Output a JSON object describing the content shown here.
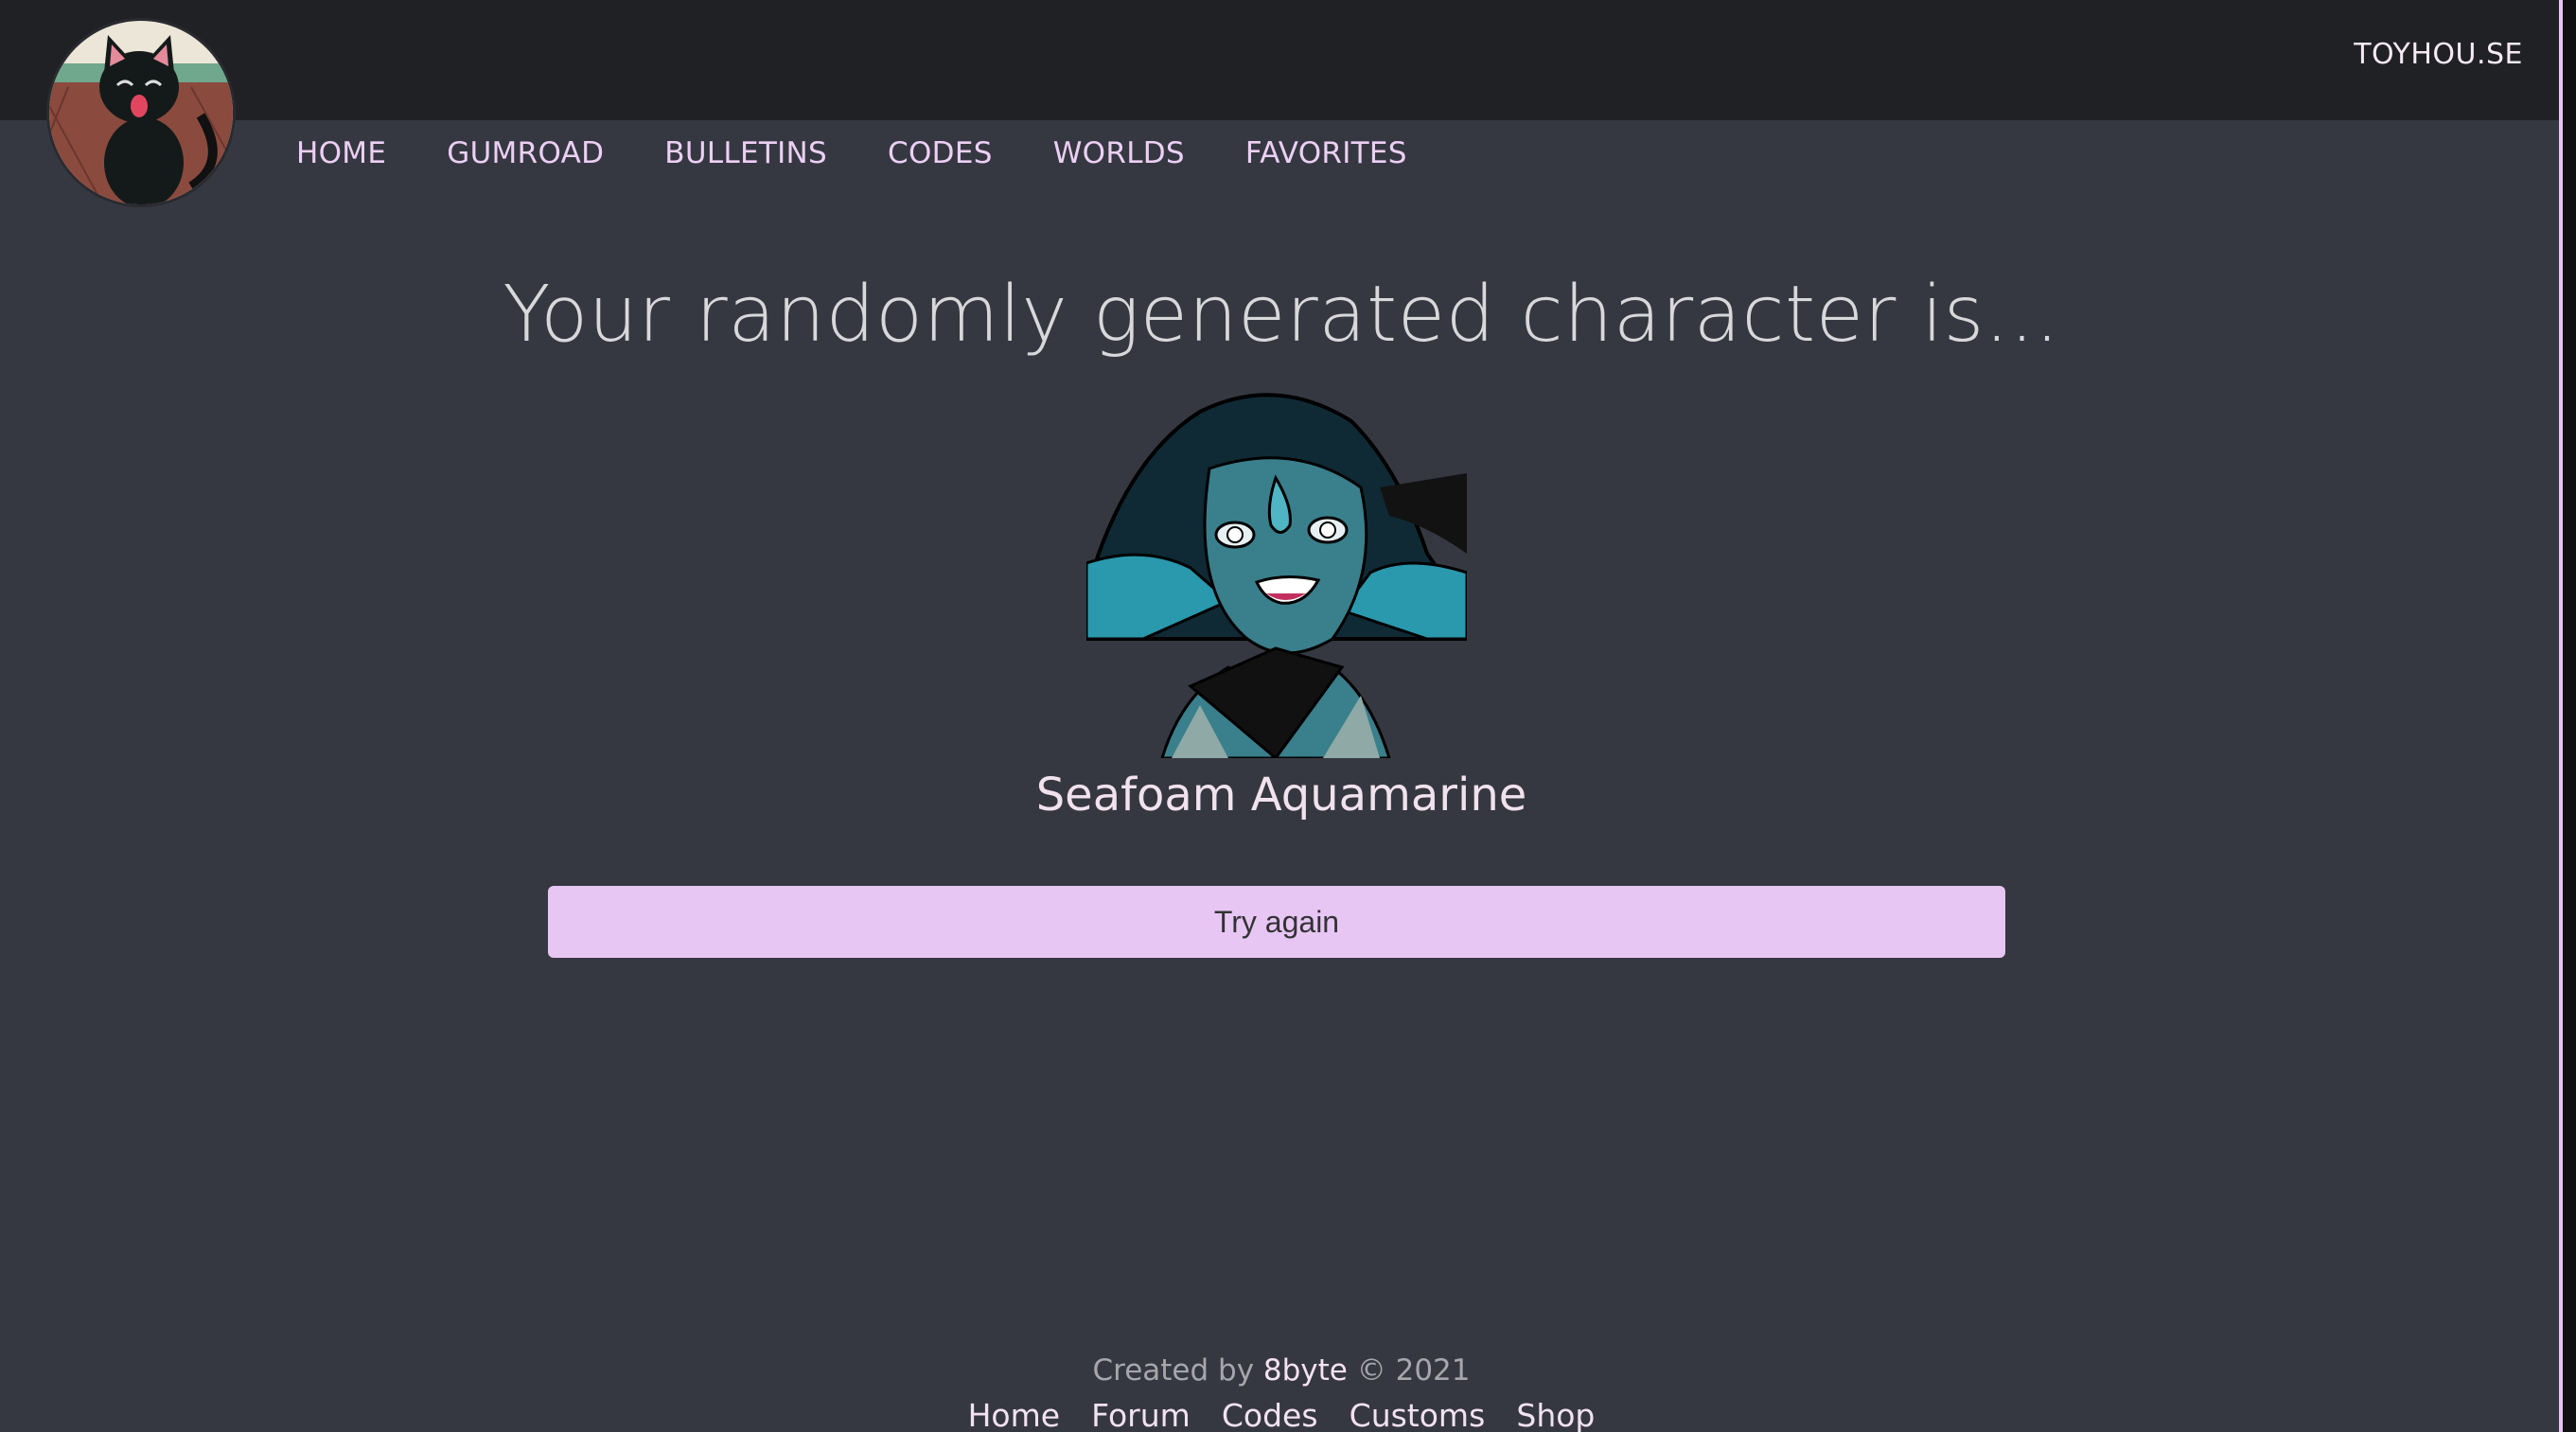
{
  "header": {
    "brand_link": "TOYHOU.SE"
  },
  "nav": {
    "items": [
      {
        "label": "HOME"
      },
      {
        "label": "GUMROAD"
      },
      {
        "label": "BULLETINS"
      },
      {
        "label": "CODES"
      },
      {
        "label": "WORLDS"
      },
      {
        "label": "FAVORITES"
      }
    ]
  },
  "main": {
    "heading": "Your randomly generated character is...",
    "character_name": "Seafoam Aquamarine",
    "try_again_label": "Try again"
  },
  "footer": {
    "created_by_prefix": "Created by",
    "author": "8byte",
    "copyright": "© 2021",
    "links": [
      "Home",
      "Forum",
      "Codes",
      "Customs",
      "Shop"
    ]
  },
  "colors": {
    "background": "#363841",
    "topbar": "#202125",
    "accent": "#e7c6f4",
    "nav_text": "#ecd0f4"
  }
}
